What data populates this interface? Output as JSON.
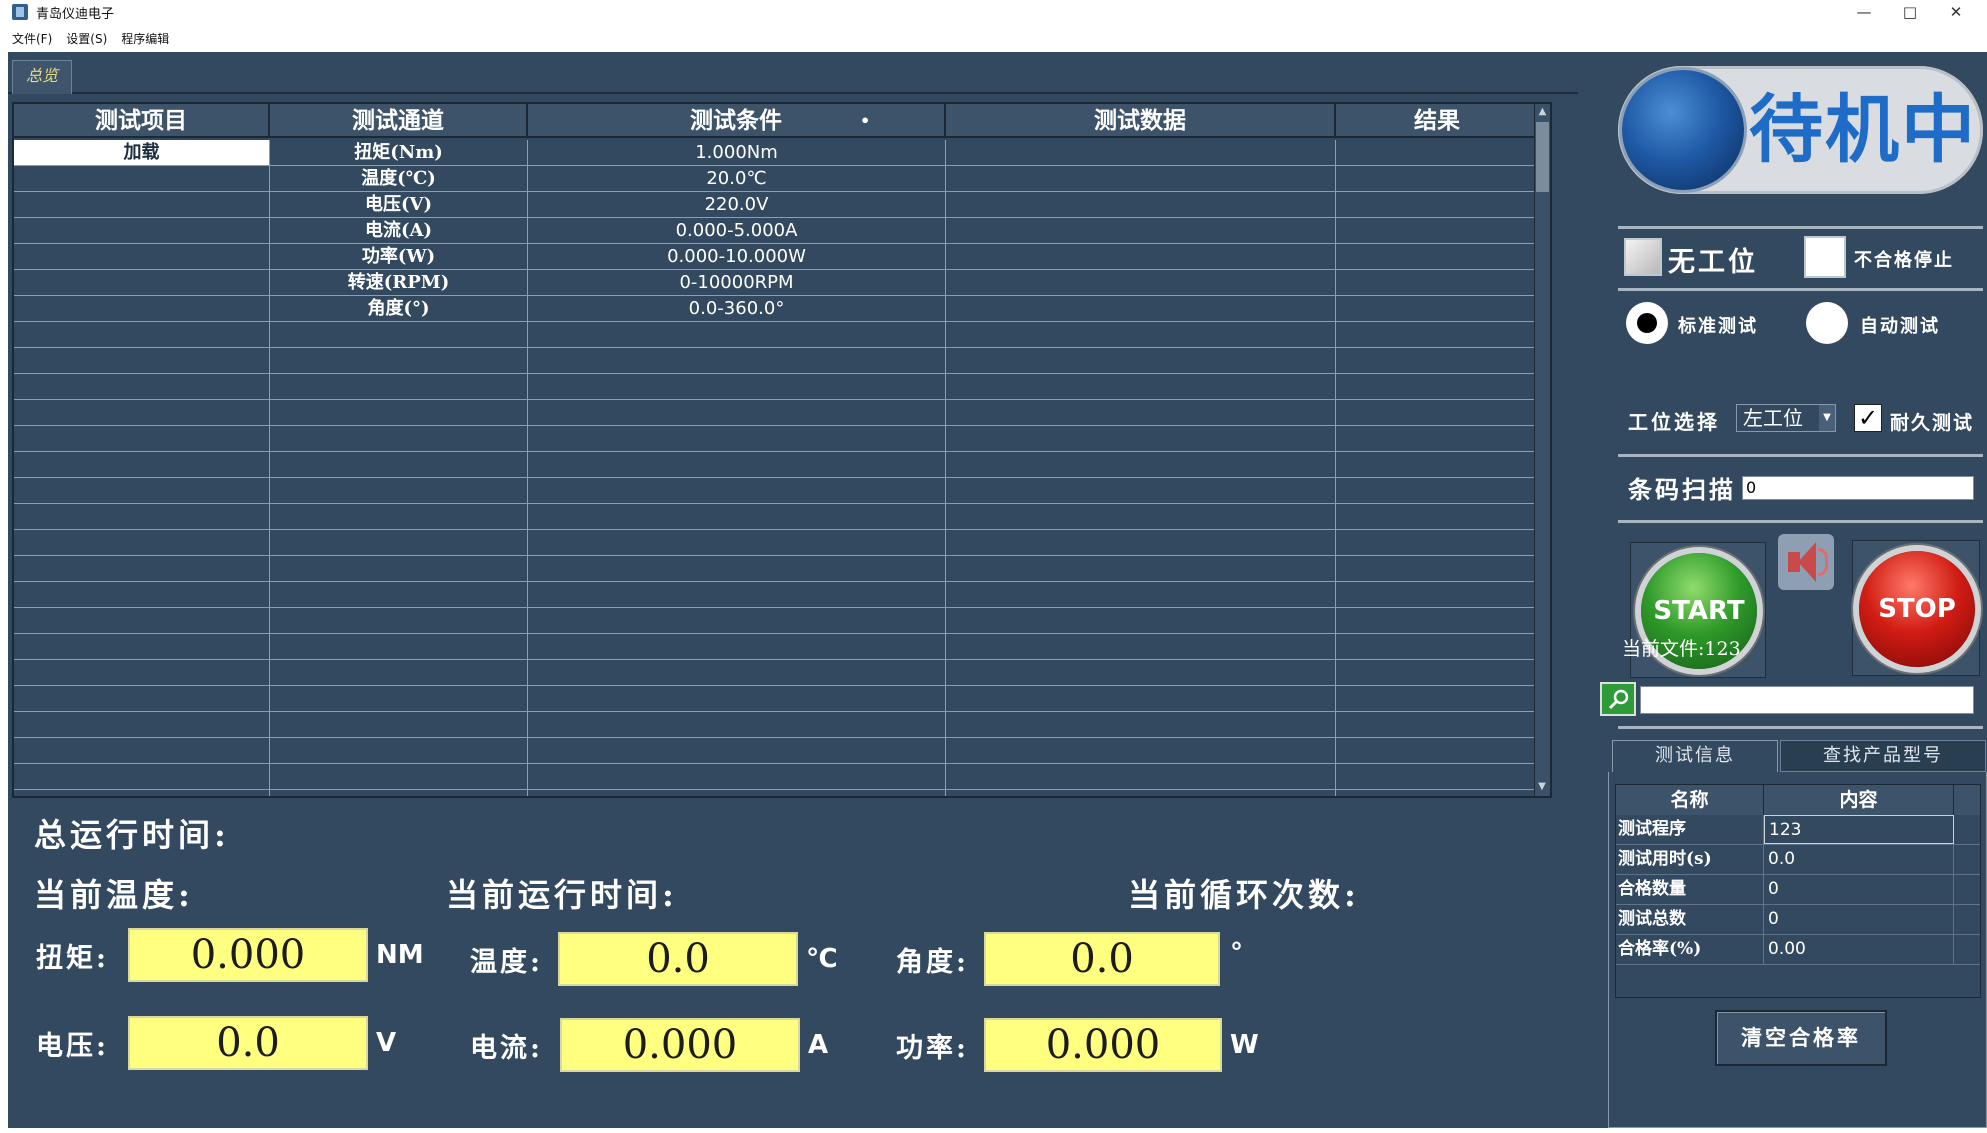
{
  "window": {
    "title": "青岛仪迪电子",
    "minimize": "—",
    "maximize": "□",
    "close": "✕"
  },
  "menu": [
    "文件(F)",
    "设置(S)",
    "程序编辑"
  ],
  "tab": {
    "label": "总览"
  },
  "grid": {
    "headers": [
      "测试项目",
      "测试通道",
      "测试条件",
      "测试数据",
      "结果"
    ],
    "header_marker": "•",
    "rows": [
      [
        "加载",
        "扭矩(Nm)",
        "1.000Nm",
        "",
        ""
      ],
      [
        "",
        "温度(℃)",
        "20.0℃",
        "",
        ""
      ],
      [
        "",
        "电压(V)",
        "220.0V",
        "",
        ""
      ],
      [
        "",
        "电流(A)",
        "0.000-5.000A",
        "",
        ""
      ],
      [
        "",
        "功率(W)",
        "0.000-10.000W",
        "",
        ""
      ],
      [
        "",
        "转速(RPM)",
        "0-10000RPM",
        "",
        ""
      ],
      [
        "",
        "角度(°)",
        "0.0-360.0°",
        "",
        ""
      ],
      [
        "",
        "",
        "",
        "",
        ""
      ],
      [
        "",
        "",
        "",
        "",
        ""
      ],
      [
        "",
        "",
        "",
        "",
        ""
      ],
      [
        "",
        "",
        "",
        "",
        ""
      ],
      [
        "",
        "",
        "",
        "",
        ""
      ],
      [
        "",
        "",
        "",
        "",
        ""
      ],
      [
        "",
        "",
        "",
        "",
        ""
      ],
      [
        "",
        "",
        "",
        "",
        ""
      ],
      [
        "",
        "",
        "",
        "",
        ""
      ],
      [
        "",
        "",
        "",
        "",
        ""
      ],
      [
        "",
        "",
        "",
        "",
        ""
      ],
      [
        "",
        "",
        "",
        "",
        ""
      ],
      [
        "",
        "",
        "",
        "",
        ""
      ],
      [
        "",
        "",
        "",
        "",
        ""
      ],
      [
        "",
        "",
        "",
        "",
        ""
      ],
      [
        "",
        "",
        "",
        "",
        ""
      ],
      [
        "",
        "",
        "",
        "",
        ""
      ],
      [
        "",
        "",
        "",
        "",
        ""
      ],
      [
        "",
        "",
        "",
        "",
        ""
      ]
    ],
    "scroll_up": "▲",
    "scroll_down": "▼"
  },
  "readouts": {
    "total_runtime_label": "总运行时间:",
    "current_temp_label": "当前温度:",
    "current_runtime_label": "当前运行时间:",
    "current_cycles_label": "当前循环次数:",
    "torque": {
      "label": "扭矩:",
      "value": "0.000",
      "unit": "NM"
    },
    "temperature": {
      "label": "温度:",
      "value": "0.0",
      "unit": "℃"
    },
    "angle": {
      "label": "角度:",
      "value": "0.0",
      "unit": "°"
    },
    "voltage": {
      "label": "电压:",
      "value": "0.0",
      "unit": "V"
    },
    "current": {
      "label": "电流:",
      "value": "0.000",
      "unit": "A"
    },
    "power": {
      "label": "功率:",
      "value": "0.000",
      "unit": "W"
    }
  },
  "right_panel": {
    "status": "待机中",
    "no_station_label": "无工位",
    "fail_stop_label": "不合格停止",
    "standard_test_label": "标准测试",
    "auto_test_label": "自动测试",
    "station_select_label": "工位选择",
    "station_value": "左工位",
    "durability_label": "耐久测试",
    "barcode_label": "条码扫描",
    "barcode_value": "0",
    "start_label": "START",
    "stop_label": "STOP",
    "current_file_label": "当前文件:123",
    "search_value": "",
    "info_tabs": [
      "测试信息",
      "查找产品型号"
    ],
    "info_headers": [
      "名称",
      "内容"
    ],
    "info_rows": [
      {
        "name": "测试程序",
        "value": "123"
      },
      {
        "name": "测试用时(s)",
        "value": "0.0"
      },
      {
        "name": "合格数量",
        "value": "0"
      },
      {
        "name": "测试总数",
        "value": "0"
      },
      {
        "name": "合格率(%)",
        "value": "0.00"
      }
    ],
    "clear_button": "清空合格率"
  },
  "colors": {
    "background": "#33495f",
    "readout_box": "#ffff80",
    "status_text": "#1f6cc8",
    "start_green": "#2f9a2a",
    "stop_red": "#d11d14"
  }
}
